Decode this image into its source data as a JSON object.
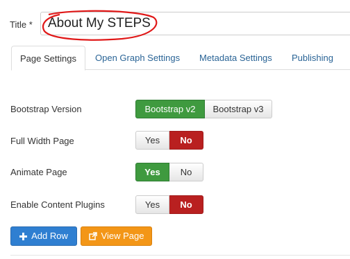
{
  "title_field": {
    "label": "Title *",
    "value": "About My STEPS"
  },
  "tabs": [
    {
      "label": "Page Settings",
      "active": true
    },
    {
      "label": "Open Graph Settings",
      "active": false
    },
    {
      "label": "Metadata Settings",
      "active": false
    },
    {
      "label": "Publishing",
      "active": false
    }
  ],
  "settings": {
    "bootstrap_version": {
      "label": "Bootstrap Version",
      "options": [
        "Bootstrap v2",
        "Bootstrap v3"
      ],
      "selected": "Bootstrap v2"
    },
    "full_width_page": {
      "label": "Full Width Page",
      "options": [
        "Yes",
        "No"
      ],
      "selected": "No"
    },
    "animate_page": {
      "label": "Animate Page",
      "options": [
        "Yes",
        "No"
      ],
      "selected": "Yes"
    },
    "enable_content_plugins": {
      "label": "Enable Content Plugins",
      "options": [
        "Yes",
        "No"
      ],
      "selected": "No"
    }
  },
  "actions": {
    "add_row": {
      "label": "Add Row",
      "icon": "plus-icon"
    },
    "view_page": {
      "label": "View Page",
      "icon": "external-link-icon"
    }
  },
  "colors": {
    "selected_green": "#3f9a3f",
    "selected_red": "#b92020",
    "primary_blue": "#2f7fd1",
    "warning_orange": "#f39617",
    "annotation_red": "#e01818"
  }
}
